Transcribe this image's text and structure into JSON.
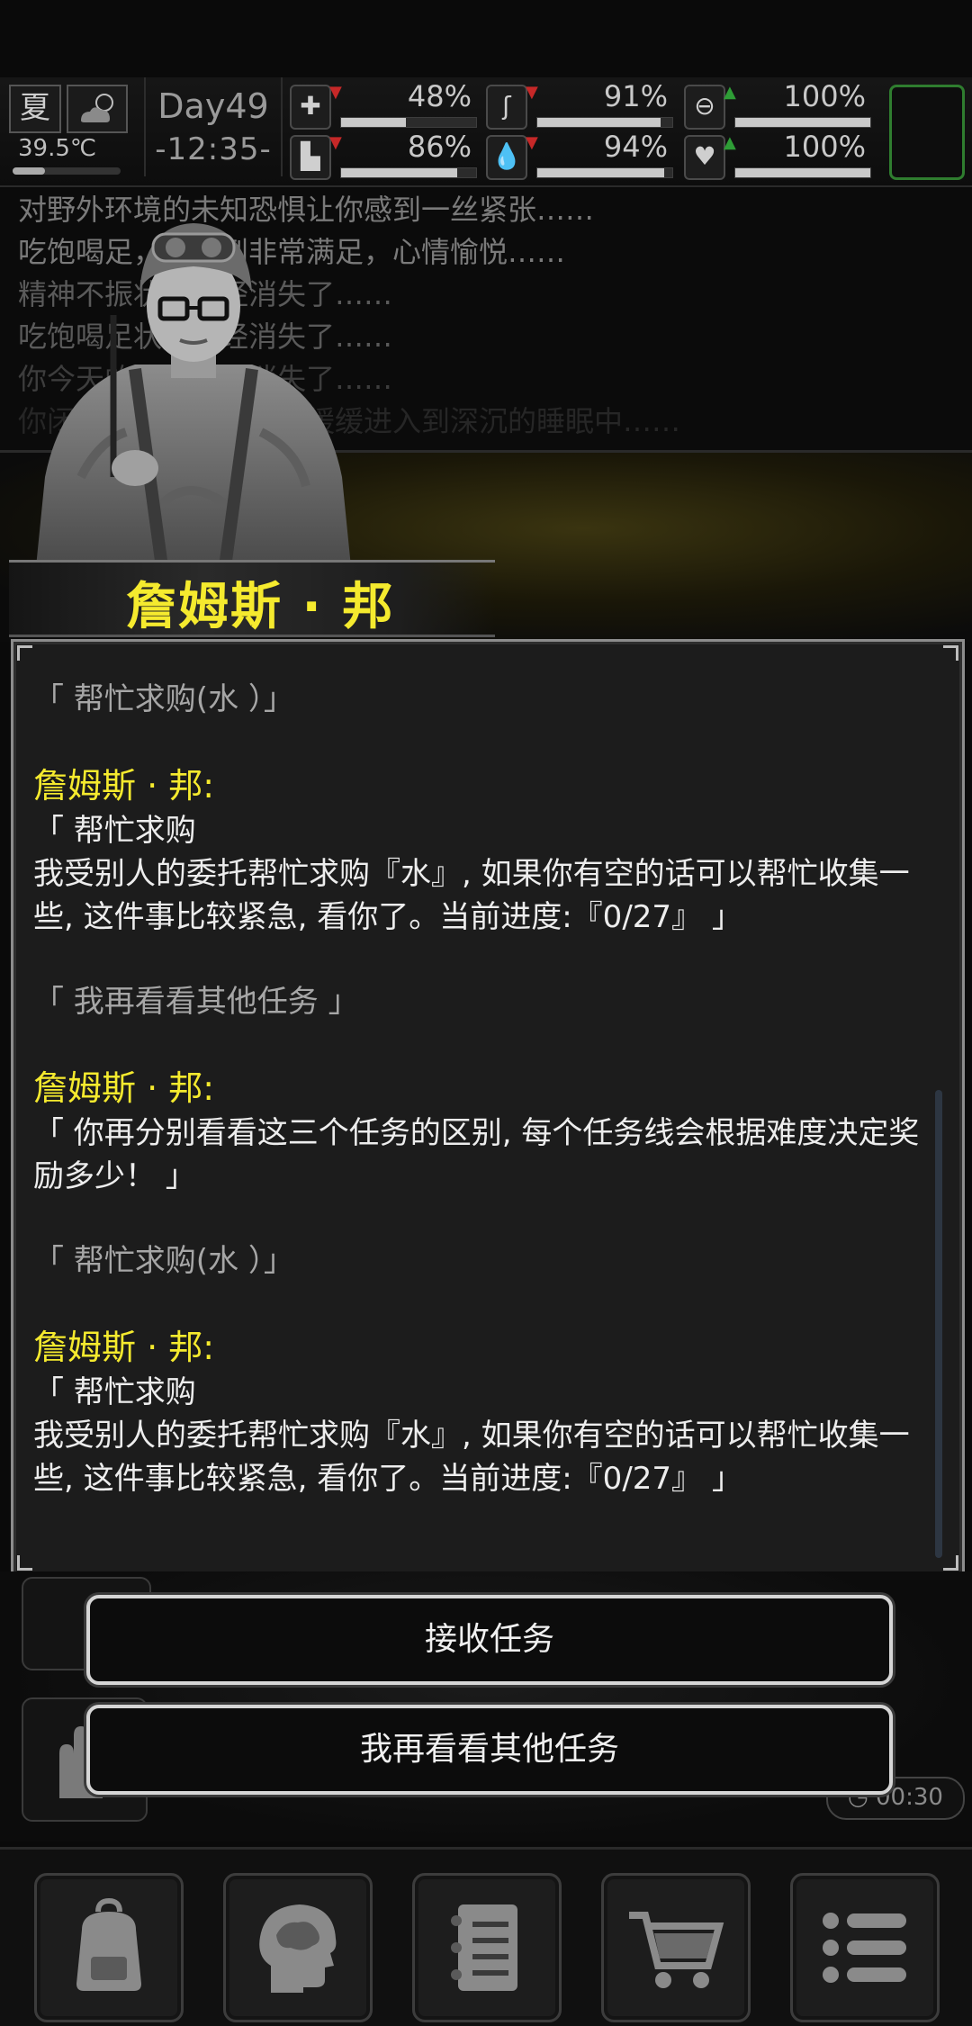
{
  "status": {
    "season": "夏",
    "temperature": "39.5℃",
    "day": "Day49",
    "time": "-12:35-",
    "stats": [
      {
        "id": "health",
        "icon": "medkit-icon",
        "trend": "down",
        "value": "48%",
        "level": 0.48
      },
      {
        "id": "hunger",
        "icon": "stomach-icon",
        "trend": "down",
        "value": "91%",
        "level": 0.91
      },
      {
        "id": "spirit",
        "icon": "pill-icon",
        "trend": "up",
        "value": "100%",
        "level": 1.0
      },
      {
        "id": "stamina",
        "icon": "boot-icon",
        "trend": "down",
        "value": "86%",
        "level": 0.86
      },
      {
        "id": "thirst",
        "icon": "water-drop-icon",
        "trend": "down",
        "value": "94%",
        "level": 0.94
      },
      {
        "id": "mood",
        "icon": "heart-icon",
        "trend": "up",
        "value": "100%",
        "level": 1.0
      }
    ]
  },
  "log": {
    "lines": [
      "对野外环境的未知恐惧让你感到一丝紧张……",
      "吃饱喝足，你感到非常满足，心情愉悦……",
      "精神不振状态已经消失了……",
      "吃饱喝足状态已经消失了……",
      "你今天的疲劳已经消失了……",
      "你闭上了疲惫的双眼，缓缓进入到深沉的睡眠中……"
    ]
  },
  "npc": {
    "name": "詹姆斯 · 邦"
  },
  "dialog": {
    "choice_1": "「 帮忙求购(水 ）」",
    "speaker_1": "詹姆斯 · 邦:",
    "speech_1": "「 帮忙求购\n我受别人的委托帮忙求购『水』, 如果你有空的话可以帮忙收集一些, 这件事比较紧急, 看你了。当前进度:『0/27』 」",
    "choice_2": "「 我再看看其他任务 」",
    "speaker_2": "詹姆斯 · 邦:",
    "speech_2": "「 你再分别看看这三个任务的区别, 每个任务线会根据难度决定奖励多少！ 」",
    "choice_3": "「 帮忙求购(水 ）」",
    "speaker_3": "詹姆斯 · 邦:",
    "speech_3": "「 帮忙求购\n我受别人的委托帮忙求购『水』, 如果你有空的话可以帮忙收集一些, 这件事比较紧急, 看你了。当前进度:『0/27』 」"
  },
  "actions": {
    "accept": "接收任务",
    "other": "我再看看其他任务"
  },
  "timer": "00:30",
  "nav": [
    {
      "id": "backpack",
      "icon": "backpack-icon"
    },
    {
      "id": "skills",
      "icon": "brain-head-icon"
    },
    {
      "id": "journal",
      "icon": "notebook-icon"
    },
    {
      "id": "shop",
      "icon": "cart-icon"
    },
    {
      "id": "menu",
      "icon": "menu-list-icon"
    }
  ]
}
